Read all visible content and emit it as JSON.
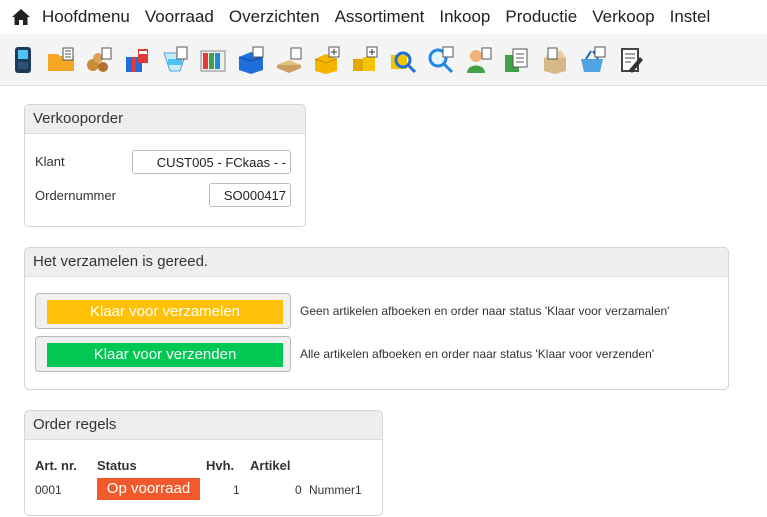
{
  "menu": {
    "items": [
      "Hoofdmenu",
      "Voorraad",
      "Overzichten",
      "Assortiment",
      "Inkoop",
      "Productie",
      "Verkoop",
      "Instel"
    ]
  },
  "toolbar": {
    "icons": [
      "scanner-icon",
      "folder-icon",
      "products-icon",
      "gift-box-icon",
      "inventory-icon",
      "shelves-icon",
      "box-stock-icon",
      "pallet-icon",
      "box-add-icon",
      "boxes-add-icon",
      "search-doc-icon",
      "search-icon",
      "user-doc-icon",
      "document-icon",
      "package-open-icon",
      "basket-doc-icon",
      "edit-doc-icon"
    ]
  },
  "order": {
    "title": "Verkooporder",
    "customer_label": "Klant",
    "customer_value": "CUST005 - FCkaas - -",
    "order_number_label": "Ordernummer",
    "order_number_value": "SO000417"
  },
  "collect": {
    "title": "Het verzamelen is gereed.",
    "btn_ready_collect": "Klaar voor verzamelen",
    "btn_ready_collect_desc": "Geen artikelen afboeken en order naar status 'Klaar voor verzamalen'",
    "btn_ready_ship": "Klaar voor verzenden",
    "btn_ready_ship_desc": "Alle artikelen afboeken en order naar status 'Klaar voor verzenden'",
    "colors": {
      "collect": "#ffc107",
      "ship": "#00c853"
    }
  },
  "lines": {
    "title": "Order regels",
    "headers": {
      "art_nr": "Art. nr.",
      "status": "Status",
      "qty": "Hvh.",
      "article": "Artikel"
    },
    "rows": [
      {
        "art_nr": "0001",
        "status": "Op voorraad",
        "qty": "1",
        "article_nr": "0",
        "article_name": "Nummer1"
      }
    ],
    "status_color": "#f25a2d"
  }
}
